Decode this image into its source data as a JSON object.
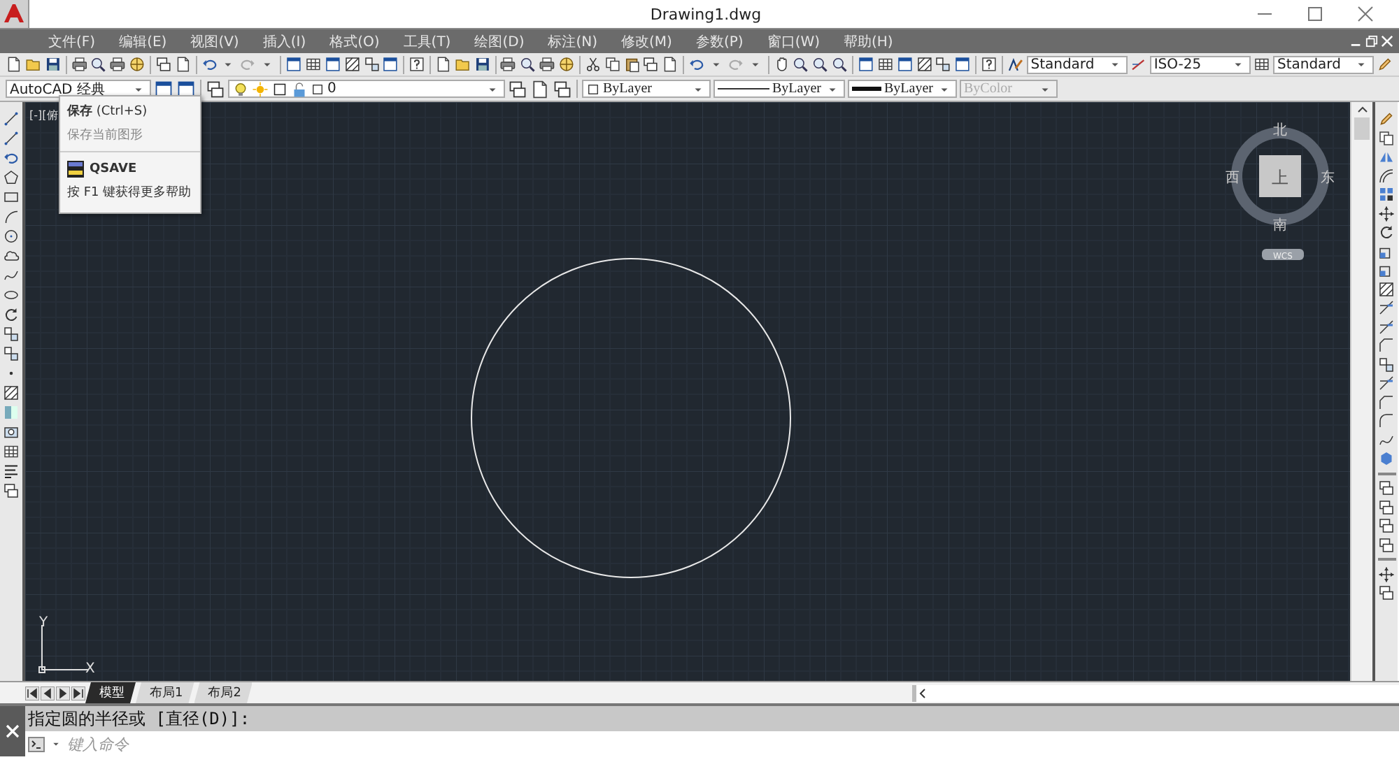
{
  "window": {
    "title": "Drawing1.dwg"
  },
  "menu": [
    "文件(F)",
    "编辑(E)",
    "视图(V)",
    "插入(I)",
    "格式(O)",
    "工具(T)",
    "绘图(D)",
    "标注(N)",
    "修改(M)",
    "参数(P)",
    "窗口(W)",
    "帮助(H)"
  ],
  "styles_toolbar": {
    "text_style": "Standard",
    "dim_style": "ISO-25",
    "table_style": "Standard"
  },
  "properties_bar": {
    "workspace": "AutoCAD 经典",
    "layer": "0",
    "color_setting": "ByLayer",
    "linetype": "ByLayer",
    "lineweight": "ByLayer",
    "plot_style": "ByColor",
    "plot_style_disabled": true
  },
  "viewport": {
    "label": "[-][俯"
  },
  "viewcube": {
    "face": "上",
    "north": "北",
    "south": "南",
    "west": "西",
    "east": "东",
    "ucs": "WCS"
  },
  "ucs_icon": {
    "x_label": "X",
    "y_label": "Y"
  },
  "tooltip": {
    "title": "保存",
    "shortcut": "(Ctrl+S)",
    "description": "保存当前图形",
    "command": "QSAVE",
    "help": "按 F1 键获得更多帮助"
  },
  "layout_tabs": [
    {
      "label": "模型",
      "selected": true
    },
    {
      "label": "布局1",
      "selected": false
    },
    {
      "label": "布局2",
      "selected": false
    }
  ],
  "command_line": {
    "history": "指定圆的半径或 [直径(D)]:",
    "placeholder": "键入命令"
  }
}
